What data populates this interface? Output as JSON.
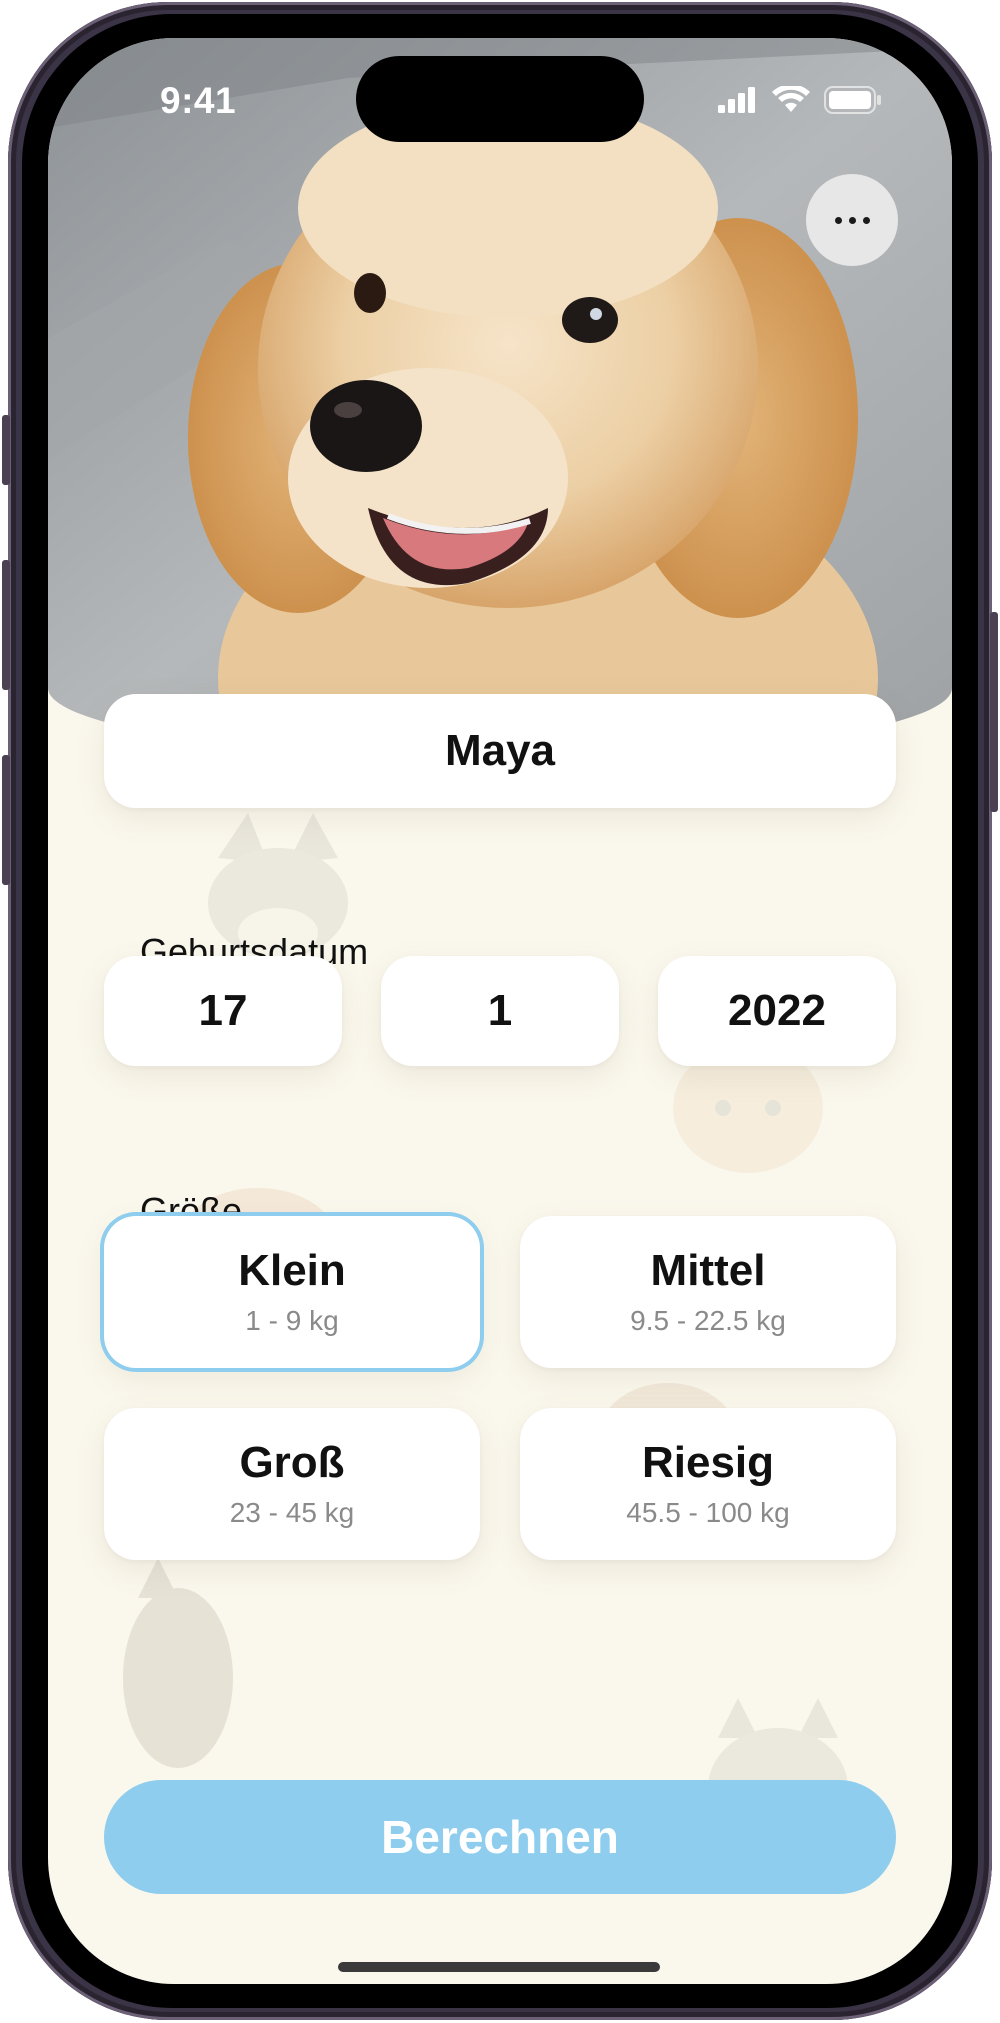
{
  "status_bar": {
    "time": "9:41"
  },
  "icons": {
    "signal": "cellular-signal-icon",
    "wifi": "wifi-icon",
    "battery": "battery-icon",
    "more": "more-dots-icon"
  },
  "pet": {
    "name": "Maya",
    "photo": "dog-photo"
  },
  "birthdate": {
    "label": "Geburtsdatum",
    "day": "17",
    "month": "1",
    "year": "2022"
  },
  "size": {
    "label": "Größe",
    "selected": "Klein",
    "options": [
      {
        "name": "Klein",
        "range": "1 - 9 kg"
      },
      {
        "name": "Mittel",
        "range": "9.5 - 22.5 kg"
      },
      {
        "name": "Groß",
        "range": "23 - 45 kg"
      },
      {
        "name": "Riesig",
        "range": "45.5 - 100 kg"
      }
    ]
  },
  "action": {
    "calculate_label": "Berechnen"
  },
  "colors": {
    "accent": "#8ecdee",
    "background": "#faf7ec",
    "card": "#ffffff",
    "frame": "#3b3346"
  }
}
